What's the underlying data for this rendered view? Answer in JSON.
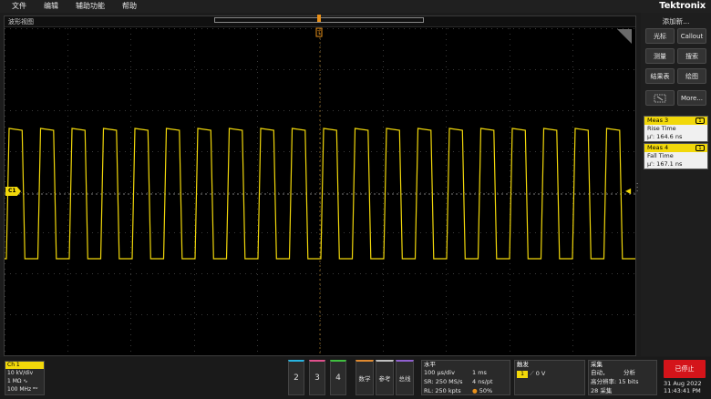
{
  "menu": {
    "items": [
      "文件",
      "编辑",
      "辅助功能",
      "帮助"
    ],
    "brand": "Tektronix"
  },
  "waveform_view": {
    "title": "波形视图",
    "channel_marker": "C1",
    "trace_color": "#f2d80a",
    "pulse_count": 20
  },
  "right_panel": {
    "add_new": "添加新...",
    "buttons": [
      "光标",
      "Callout",
      "测量",
      "搜索",
      "结果表",
      "绘图",
      "",
      "More..."
    ],
    "meas3": {
      "title": "Meas 3",
      "badge": "1",
      "name": "Rise Time",
      "value": "μ': 164.6 ns"
    },
    "meas4": {
      "title": "Meas 4",
      "badge": "1",
      "name": "Fall Time",
      "value": "μ': 167.1 ns"
    }
  },
  "bottom": {
    "ch1": {
      "title": "Ch 1",
      "scale": "10 kV/div",
      "impedance": "1 MΩ",
      "bandwidth": "100 MHz"
    },
    "channels": [
      {
        "label": "2",
        "color": "#28b4e0"
      },
      {
        "label": "3",
        "color": "#e0508c"
      },
      {
        "label": "4",
        "color": "#40c040"
      }
    ],
    "tools": [
      {
        "label": "数学",
        "color": "#e08a30"
      },
      {
        "label": "参考",
        "color": "#c0c0c0"
      },
      {
        "label": "总线",
        "color": "#9060d0"
      }
    ],
    "horizontal": {
      "title": "水平",
      "tdiv": "100 μs/div",
      "total": "1 ms",
      "sr": "SR: 250 MS/s",
      "res": "4 ns/pt",
      "rl": "RL: 250 kpts",
      "pos": "50%"
    },
    "trigger": {
      "title": "触发",
      "source": "1",
      "level": "0 V"
    },
    "acquisition": {
      "title": "采集",
      "mode": "自动，",
      "analyze": "分析",
      "hires": "高分辨率: 15 bits",
      "count": "28 采集"
    },
    "stop_label": "已停止",
    "date": "31 Aug 2022",
    "time": "11:43:41 PM"
  }
}
